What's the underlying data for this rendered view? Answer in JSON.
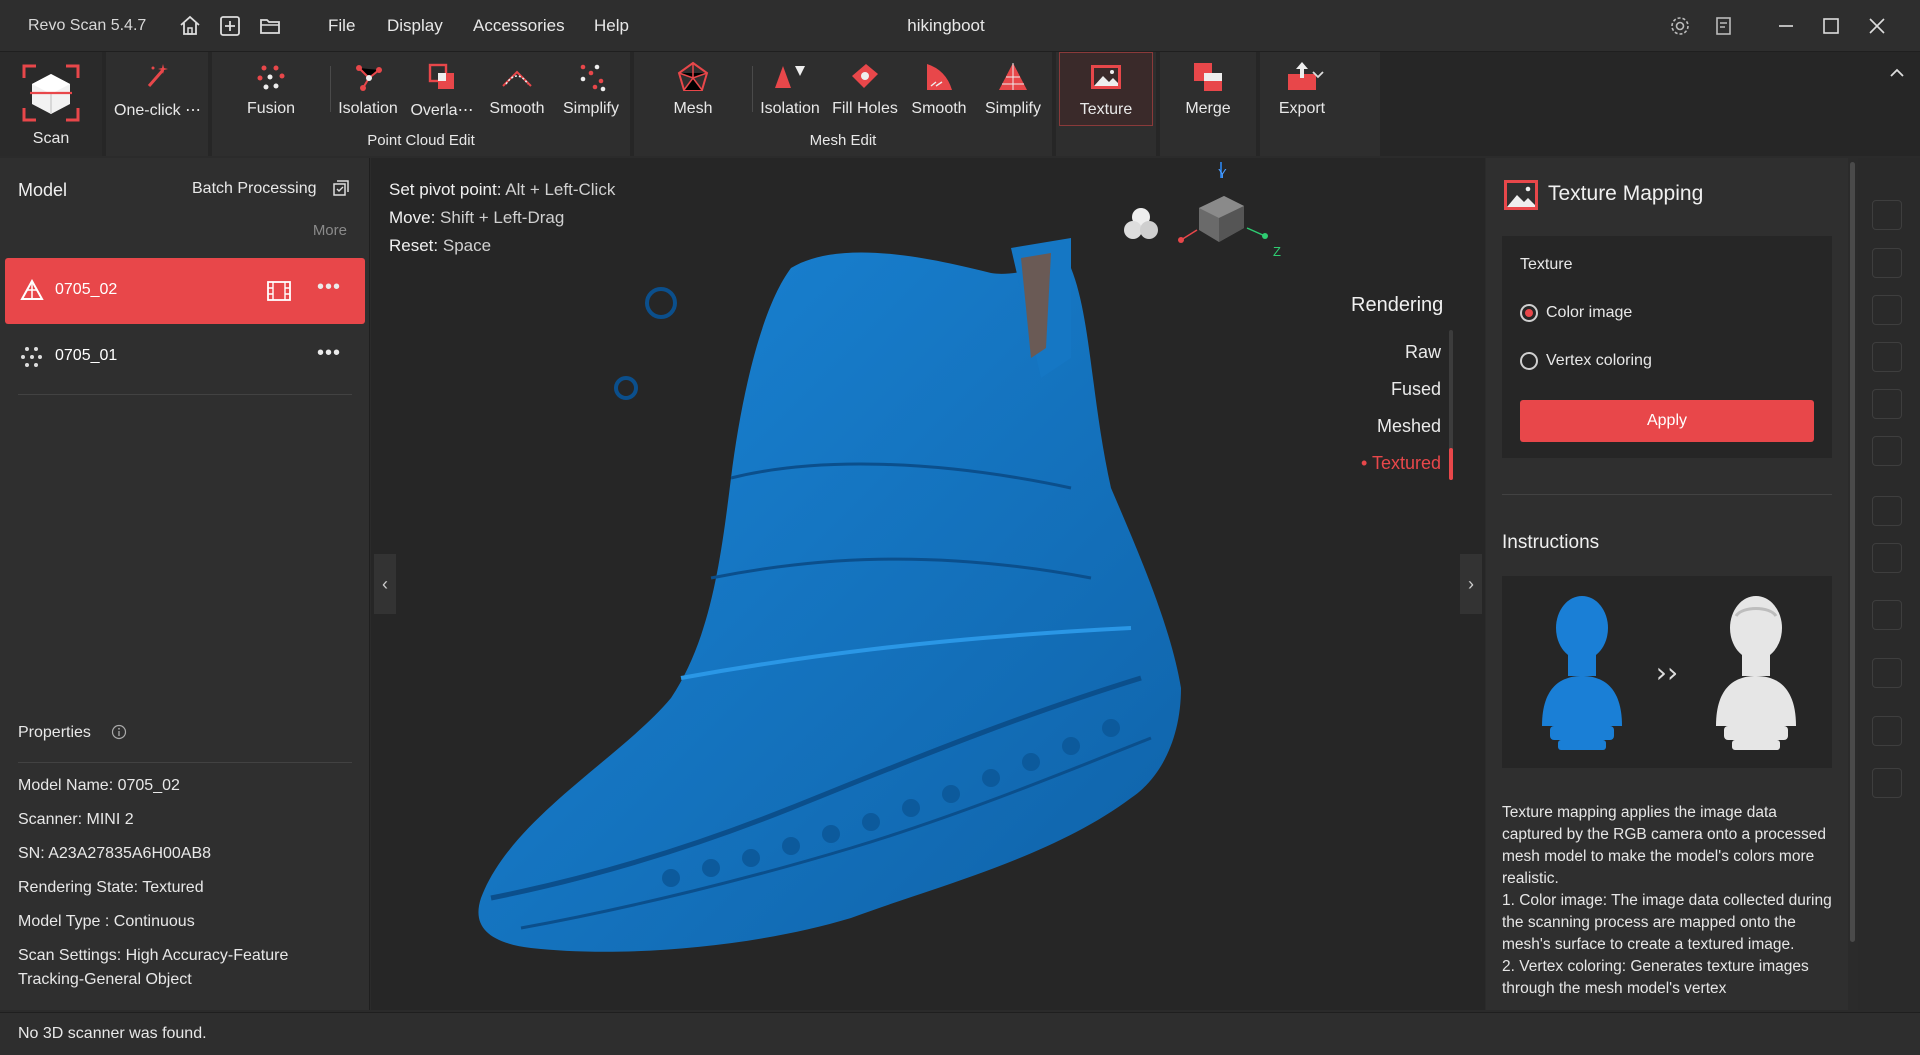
{
  "titlebar": {
    "app_name": "Revo Scan 5.4.7",
    "menu": [
      "File",
      "Display",
      "Accessories",
      "Help"
    ],
    "doc_title": "hikingboot"
  },
  "toolbar": {
    "scan": "Scan",
    "one_click": "One-click ⋯",
    "fusion": "Fusion",
    "pc_isolation": "Isolation",
    "overlap": "Overla⋯",
    "pc_smooth": "Smooth",
    "pc_simplify": "Simplify",
    "mesh": "Mesh",
    "mesh_isolation": "Isolation",
    "fill_holes": "Fill Holes",
    "mesh_smooth": "Smooth",
    "mesh_simplify": "Simplify",
    "texture": "Texture",
    "merge": "Merge",
    "export": "Export",
    "group_point_cloud": "Point Cloud Edit",
    "group_mesh": "Mesh Edit"
  },
  "left": {
    "title": "Model",
    "batch": "Batch Processing",
    "more": "More",
    "models": [
      {
        "name": "0705_02",
        "active": true
      },
      {
        "name": "0705_01",
        "active": false
      }
    ],
    "properties_title": "Properties",
    "properties": [
      "Model Name:  0705_02",
      "Scanner:   MINI 2",
      "SN:  A23A27835A6H00AB8",
      "Rendering State:  Textured",
      "Model Type :  Continuous",
      "Scan Settings:  High Accuracy-Feature Tracking-General Object"
    ]
  },
  "viewport": {
    "hints": [
      {
        "label": "Set pivot point:",
        "key": "Alt + Left-Click"
      },
      {
        "label": "Move:",
        "key": "Shift + Left-Drag"
      },
      {
        "label": "Reset:",
        "key": "Space"
      }
    ],
    "rendering_title": "Rendering",
    "render_modes": [
      "Raw",
      "Fused",
      "Meshed",
      "Textured"
    ],
    "active_mode": "Textured",
    "axis_y": "Y",
    "axis_z": "Z",
    "mesh_color": "#1577c4"
  },
  "right": {
    "title": "Texture Mapping",
    "texture_label": "Texture",
    "options": [
      "Color image",
      "Vertex coloring"
    ],
    "selected": "Color image",
    "apply": "Apply",
    "instructions_title": "Instructions",
    "instructions_text": "Texture mapping applies the image data captured by the RGB camera onto a processed mesh model to make the model's colors more realistic.\n1. Color image: The image data collected during the scanning process are mapped onto the mesh's surface to create a textured image.\n2. Vertex coloring: Generates texture images through the mesh model's vertex"
  },
  "status": "No 3D scanner was found.",
  "colors": {
    "accent": "#e8474a",
    "bg": "#2b2b2b",
    "mesh": "#1577c4"
  }
}
